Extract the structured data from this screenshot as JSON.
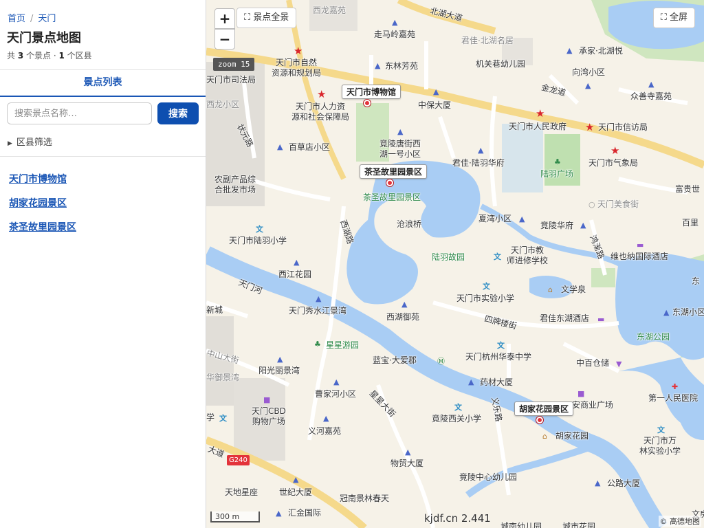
{
  "breadcrumb": {
    "home": "首页",
    "sep": "/",
    "current": "天门"
  },
  "title": "天门景点地图",
  "summary": {
    "prefix": "共 ",
    "spots": "3",
    "mid": " 个景点 · ",
    "districts": "1",
    "suffix": " 个区县"
  },
  "tab": {
    "label": "景点列表"
  },
  "search": {
    "placeholder": "搜索景点名称…",
    "value": "",
    "button": "搜索"
  },
  "filter": {
    "arrow": "▶",
    "label": "区县筛选"
  },
  "spots": [
    {
      "name": "天门市博物馆"
    },
    {
      "name": "胡家花园景区"
    },
    {
      "name": "茶圣故里园景区"
    }
  ],
  "map": {
    "zoom_in": "+",
    "zoom_out": "−",
    "fit_all": "⛶ 景点全景",
    "fullscreen": "⛶ 全屏",
    "zoom_badge": "zoom 15",
    "scale": "300 m",
    "watermark": "kjdf.cn 2.441",
    "attribution": "© 高德地图",
    "markers": [
      "天门市博物馆",
      "茶圣故里园景区",
      "胡家花园景区"
    ],
    "labels": {
      "xilongjiayuan": "西龙嘉苑",
      "beihudadao": "北湖大道",
      "zoumaling": "走马岭嘉苑",
      "junjiabeihu": "君佳·北湖名居",
      "chengjiabeihu": "承家·北湖悦",
      "ziran": "天门市自然\n资源和规划局",
      "donglin": "东林芳苑",
      "jiguanxiang": "机关巷幼儿园",
      "xiangwan": "向湾小区",
      "sifaju": "天门市司法局",
      "jinlongdao": "金龙道",
      "zhongshansi": "众善寺嘉苑",
      "xilongxiaoqu": "西龙小区",
      "renli": "天门市人力资\n源和社会保障局",
      "zhongbao": "中保大厦",
      "renmin": "天门市人民政府",
      "xinfang": "天门市信访局",
      "zhuangyuanlu": "状元路",
      "jingling": "竟陵唐街西\n湖一号小区",
      "baicaodian": "百草店小区",
      "lvyufu": "君佳·陆羽华府",
      "qixiang": "天门市气象局",
      "lvyuguangchang": "陆羽广场",
      "fugui": "富贵世",
      "nongfu": "农副产品综\n合批发市场",
      "chasheng": "茶圣故里园景区",
      "meishijie": "天门美食街",
      "canglang": "沧浪桥",
      "xiawan": "夏湾小区",
      "jinglinghuafu": "竟陵华府",
      "baili": "百里",
      "xihulu": "西湖路",
      "lvyuxiaoxue": "天门市陆羽小学",
      "lvyuguyuan": "陆羽故园",
      "jiaoshi": "天门市教\n师进修学校",
      "hongjian": "鸿渐路",
      "weina": "维也纳国际酒店",
      "xijiang": "西江花园",
      "tianmenhe": "天门河",
      "wenxuequan": "文学泉",
      "dong": "东",
      "shiyan": "天门市实验小学",
      "xincheng": "新城",
      "xiushui": "天门秀水江景湾",
      "xihuyuyuan": "西湖御苑",
      "sipailou": "四牌楼街",
      "dongdonghu": "东湖小区",
      "junjiadonghu": "君佳东湖酒店",
      "donghupark": "东湖公园",
      "xingxing": "星星游园",
      "zhongshan": "中山大街",
      "lanbao": "蓝宝·大爱郡",
      "huatai": "天门杭州华泰中学",
      "yangguang": "阳光丽景湾",
      "zhongbaicang": "中百仓储",
      "huayu": "华御景湾",
      "yaocai": "药材大厦",
      "caojia": "曹家河小区",
      "xingzhan": "星星大街",
      "anshangye": "安商业广场",
      "diyiyiyuan": "第一人民医院",
      "cbd": "天门CBD\n购物广场",
      "xue": "学",
      "yihe": "义河嘉苑",
      "jinglingxiguan": "竟陵西关小学",
      "yilu": "义乐路",
      "hujiahuayuan": "胡家花园",
      "wanlin": "天门市万\n林实验小学",
      "dadao": "大道",
      "g240": "G240",
      "wumao": "物贸大厦",
      "jinglingzhongxin": "竟陵中心幼儿园",
      "tiandixingzuo": "天地星座",
      "shiji": "世纪大厦",
      "gonglu": "公路大厦",
      "guannan": "冠南景林春天",
      "huijin": "汇金国际",
      "chengnanyou": "城南幼儿园",
      "chengshihua": "城市花园",
      "wen": "文房"
    }
  }
}
